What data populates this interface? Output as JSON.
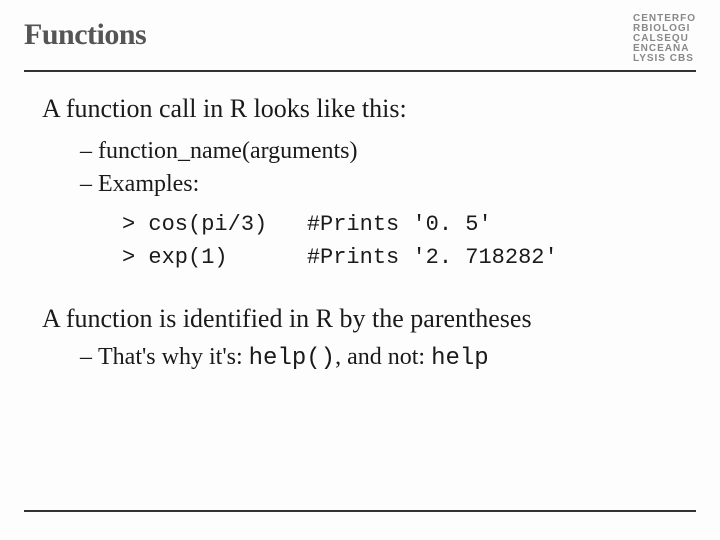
{
  "header": {
    "title": "Functions",
    "logo_lines": "CENTERFO\nRBIOLOGI\nCALSEQU\nENCEANA\nLYSIS CBS"
  },
  "body": {
    "lead1": "A function call in R looks like this:",
    "sub1": "function_name(arguments)",
    "sub2": "Examples:",
    "code": "> cos(pi/3)   #Prints '0. 5'\n> exp(1)      #Prints '2. 718282'",
    "lead2": "A function is identified in R by the parentheses",
    "sub3_pre": "That's why it's: ",
    "sub3_code1": "help()",
    "sub3_mid": ", and not:  ",
    "sub3_code2": "help"
  }
}
